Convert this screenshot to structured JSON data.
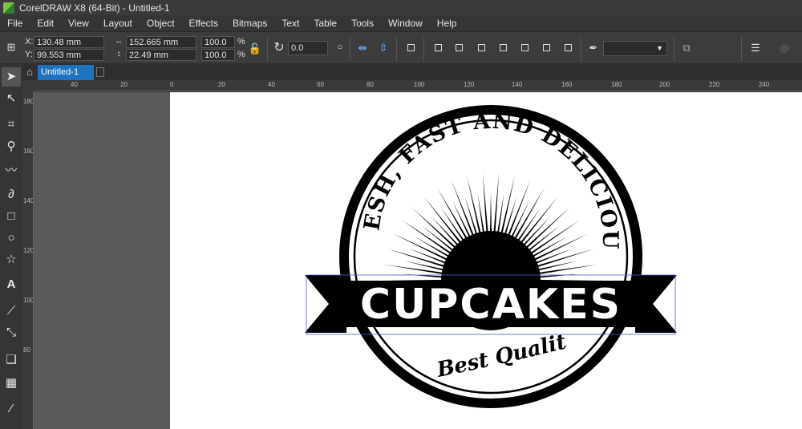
{
  "window": {
    "title": "CorelDRAW X8 (64-Bit) - Untitled-1"
  },
  "menu": [
    "File",
    "Edit",
    "View",
    "Layout",
    "Object",
    "Effects",
    "Bitmaps",
    "Text",
    "Table",
    "Tools",
    "Window",
    "Help"
  ],
  "property_bar": {
    "x_label": "X:",
    "x_value": "130.48 mm",
    "y_label": "Y:",
    "y_value": "99.553 mm",
    "width_value": "152.665 mm",
    "height_value": "22.49 mm",
    "scale_w": "100.0",
    "scale_h": "100.0",
    "percent": "%",
    "rotation_value": "0.0",
    "outline_width_value": ""
  },
  "document_tab": {
    "label": "Untitled-1"
  },
  "ruler_h": [
    "40",
    "20",
    "0",
    "20",
    "40",
    "60",
    "80",
    "100",
    "120",
    "140",
    "160",
    "180",
    "200",
    "220",
    "240"
  ],
  "ruler_v": [
    "180",
    "160",
    "140",
    "120",
    "100",
    "80"
  ],
  "artwork": {
    "top_text": "FRESH, FAST AND DELICIOUS",
    "banner_text": "CUPCAKES",
    "bottom_text": "Best Quality",
    "ink_color": "#000000",
    "paper_color": "#ffffff"
  }
}
